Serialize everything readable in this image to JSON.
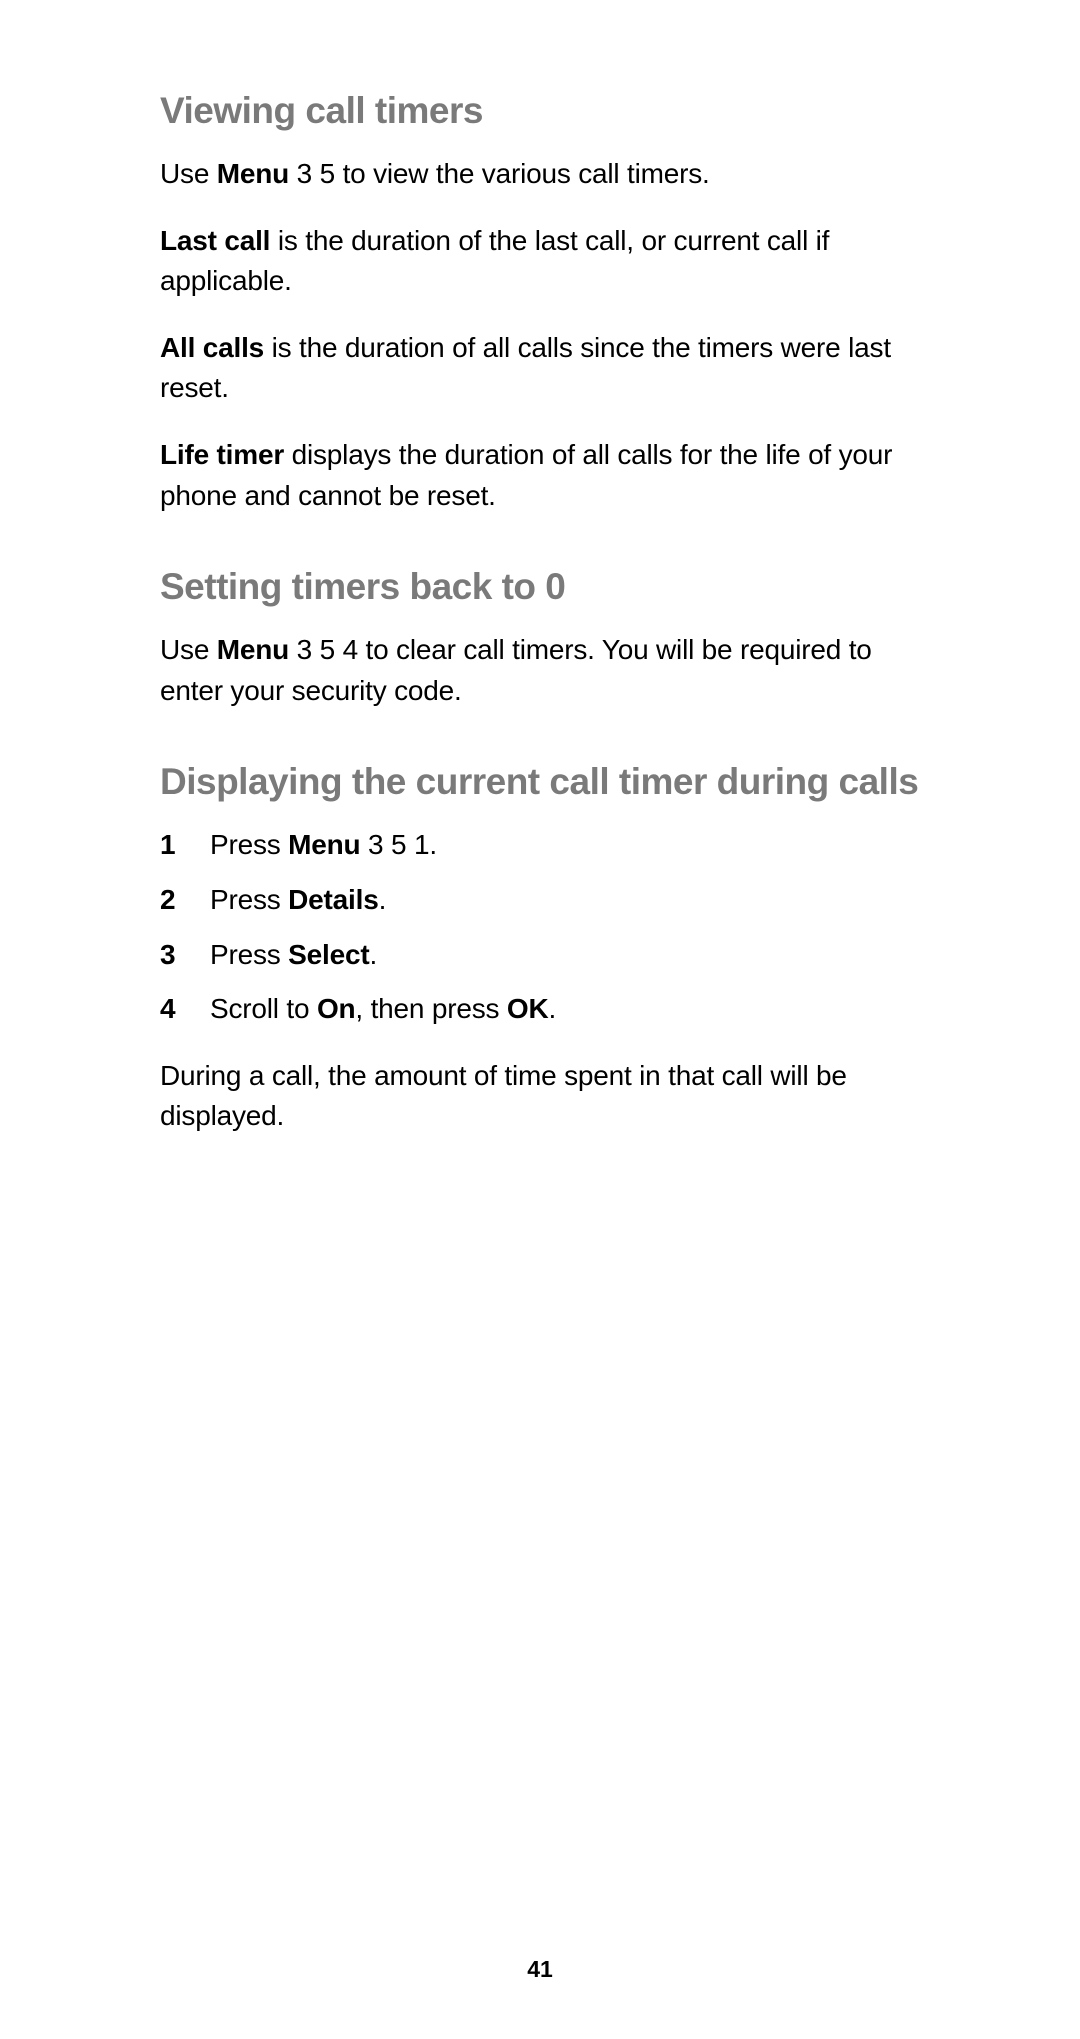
{
  "sections": {
    "s1": {
      "heading": "Viewing call timers",
      "p1_a": "Use ",
      "p1_b": "Menu",
      "p1_c": " 3 5 to view the various call timers.",
      "p2_a": "Last call",
      "p2_b": " is the duration of the last call, or current call if applicable.",
      "p3_a": "All calls",
      "p3_b": " is the duration of all calls since the timers were last reset.",
      "p4_a": "Life timer",
      "p4_b": " displays the duration of all calls for the life of your phone and cannot be reset."
    },
    "s2": {
      "heading": "Setting timers back to 0",
      "p1_a": "Use ",
      "p1_b": "Menu",
      "p1_c": " 3 5 4 to clear call timers. You will be required to enter your security code."
    },
    "s3": {
      "heading": "Displaying the current call timer during calls",
      "li1_n": "1",
      "li1_a": "Press ",
      "li1_b": "Menu",
      "li1_c": " 3 5 1.",
      "li2_n": "2",
      "li2_a": "Press ",
      "li2_b": "Details",
      "li2_c": ".",
      "li3_n": "3",
      "li3_a": "Press ",
      "li3_b": "Select",
      "li3_c": ".",
      "li4_n": "4",
      "li4_a": "Scroll to ",
      "li4_b": "On",
      "li4_c": ", then press ",
      "li4_d": "OK",
      "li4_e": ".",
      "p1": "During a call, the amount of time spent in that call will be displayed."
    }
  },
  "page_number": "41"
}
